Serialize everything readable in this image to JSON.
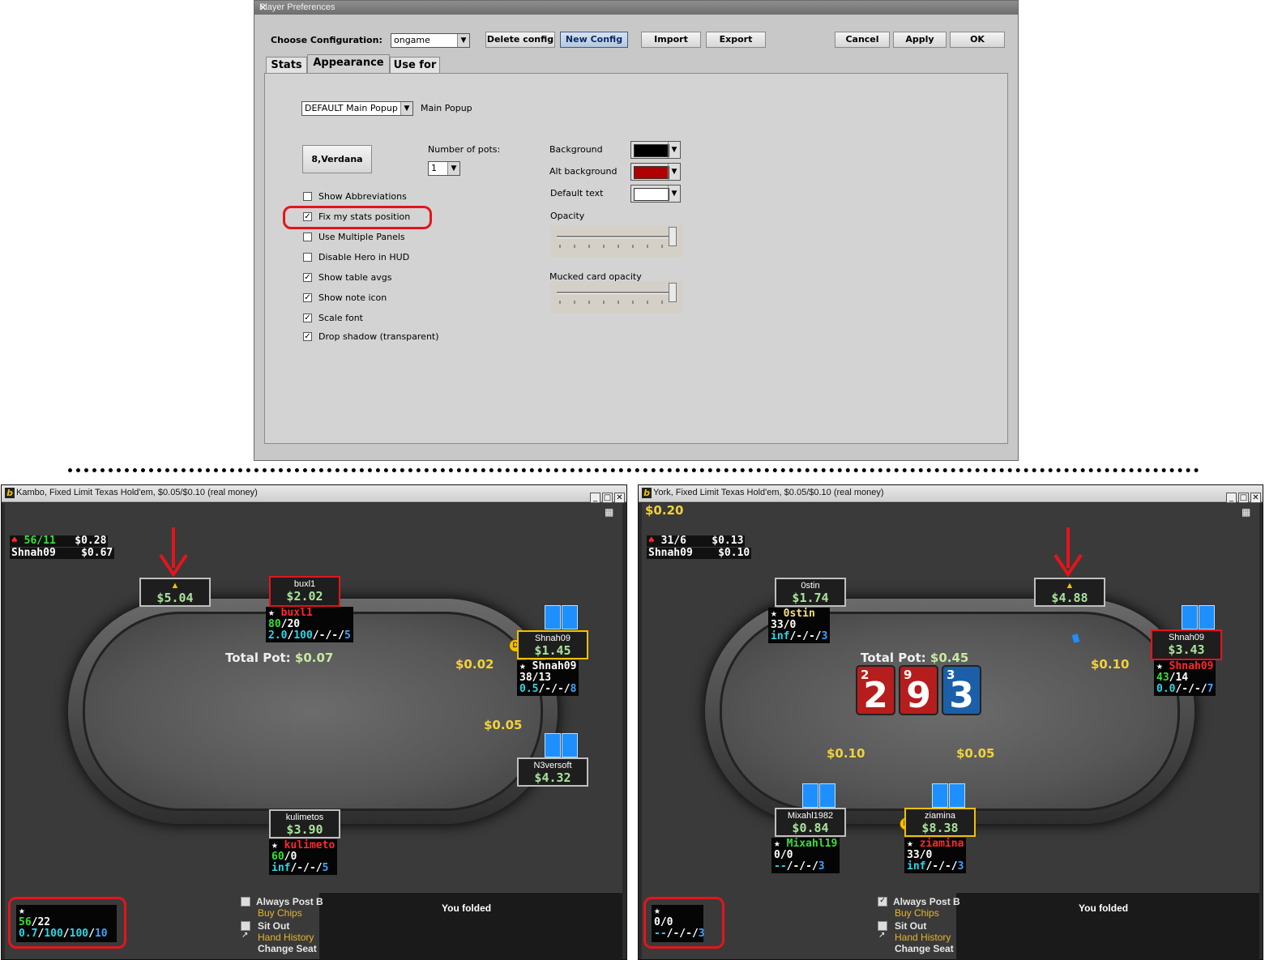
{
  "dialog": {
    "title": "Player Preferences",
    "close": "✕",
    "choose_config_label": "Choose Configuration:",
    "config_value": "ongame",
    "buttons": {
      "delete": "Delete config",
      "new": "New Config",
      "import": "Import",
      "export": "Export",
      "cancel": "Cancel",
      "apply": "Apply",
      "ok": "OK"
    },
    "tabs": [
      "Stats",
      "Appearance",
      "Use for"
    ],
    "popup_select": "DEFAULT Main Popup",
    "popup_label": "Main Popup",
    "font_button": "8,Verdana",
    "num_pots_label": "Number of pots:",
    "num_pots_value": "1",
    "checkboxes": [
      {
        "label": "Show Abbreviations",
        "checked": false
      },
      {
        "label": "Fix my stats position",
        "checked": true
      },
      {
        "label": "Use Multiple Panels",
        "checked": false
      },
      {
        "label": "Disable Hero in HUD",
        "checked": false
      },
      {
        "label": "Show table avgs",
        "checked": true
      },
      {
        "label": "Show note icon",
        "checked": true
      },
      {
        "label": "Scale font",
        "checked": true
      },
      {
        "label": "Drop shadow (transparent)",
        "checked": true
      }
    ],
    "colors": [
      {
        "label": "Background",
        "value": "#000000"
      },
      {
        "label": "Alt background",
        "value": "#b10000"
      },
      {
        "label": "Default text",
        "value": "#ffffff"
      }
    ],
    "opacity_label": "Opacity",
    "mucked_label": "Mucked card opacity"
  },
  "left_table": {
    "title": "Kambo, Fixed Limit Texas Hold'em, $0.05/$0.10 (real money)",
    "logo": "b",
    "top_stats": {
      "line1a": "56/11",
      "line1b": "$0.28",
      "line2a": "Shnah09",
      "line2b": "$0.67"
    },
    "total_pot_label": "Total Pot:",
    "total_pot": "$0.07",
    "seats": [
      {
        "name": "",
        "stack": "$5.04"
      },
      {
        "name": "buxl1",
        "stack": "$2.02"
      },
      {
        "name": "Shnah09",
        "stack": "$1.45"
      },
      {
        "name": "N3versoft",
        "stack": "$4.32"
      },
      {
        "name": "kulimetos",
        "stack": "$3.90"
      }
    ],
    "huds": [
      {
        "star": "★",
        "name": "buxl1",
        "l2a": "80",
        "l2b": "/20",
        "l3": [
          "2.0",
          "/",
          "100",
          "/-/-/",
          "5"
        ]
      },
      {
        "star": "★",
        "name": "Shnah09",
        "l2a": "38/13",
        "l3": [
          "0.5",
          "/-/-/",
          "8"
        ]
      },
      {
        "star": "★",
        "name": "kulimeto",
        "l2a": "60",
        "l2b": "/0",
        "l3": [
          "inf",
          "/-/-/",
          "5"
        ]
      }
    ],
    "bets": [
      "$0.02",
      "$0.05"
    ],
    "hero_hud": {
      "star": "★",
      "l2a": "56",
      "l2b": "/22",
      "l3": [
        "0.7",
        "/",
        "100",
        "/",
        "100",
        "/",
        "10"
      ]
    },
    "options": {
      "always_post": "Always Post B",
      "buy_chips": "Buy Chips",
      "sit_out": "Sit Out",
      "hand_history": "Hand History",
      "change_seat": "Change Seat"
    },
    "folded": "You folded"
  },
  "right_table": {
    "title": "York, Fixed Limit Texas Hold'em, $0.05/$0.10 (real money)",
    "logo": "b",
    "corner_amount": "$0.20",
    "top_stats": {
      "line1a": "31/6",
      "line1b": "$0.13",
      "line2a": "Shnah09",
      "line2b": "$0.10"
    },
    "total_pot_label": "Total Pot:",
    "total_pot": "$0.45",
    "board": [
      {
        "rank": "2",
        "color": "#b61d1d"
      },
      {
        "rank": "9",
        "color": "#b61d1d"
      },
      {
        "rank": "3",
        "color": "#1b5fa8"
      }
    ],
    "seats": [
      {
        "name": "0stin",
        "stack": "$1.74"
      },
      {
        "name": "",
        "stack": "$4.88"
      },
      {
        "name": "Shnah09",
        "stack": "$3.43"
      },
      {
        "name": "Mixahl1982",
        "stack": "$0.84"
      },
      {
        "name": "ziamina",
        "stack": "$8.38"
      }
    ],
    "huds": [
      {
        "star": "★",
        "name": "0stin",
        "l2a": "33/0",
        "l3": [
          "inf",
          "/-/-/",
          "3"
        ]
      },
      {
        "star": "★",
        "name": "Shnah09",
        "l2a": "43",
        "l2b": "/14",
        "l3": [
          "0.0",
          "/-/-/",
          "7"
        ]
      },
      {
        "star": "★",
        "name": "Mixahl19",
        "l2a": "0/0",
        "l3": [
          "--",
          "/-/-/",
          "3"
        ]
      },
      {
        "star": "★",
        "name": "ziamina",
        "l2a": "33/0",
        "l3": [
          "inf",
          "/-/-/",
          "3"
        ]
      }
    ],
    "bets": [
      "$0.10",
      "$0.10",
      "$0.05"
    ],
    "hero_hud": {
      "star": "★",
      "l2a": "0/0",
      "l3": [
        "--",
        "/-/-/",
        "3"
      ]
    },
    "options": {
      "always_post": "Always Post B",
      "buy_chips": "Buy Chips",
      "sit_out": "Sit Out",
      "hand_history": "Hand History",
      "change_seat": "Change Seat"
    },
    "folded": "You folded"
  }
}
